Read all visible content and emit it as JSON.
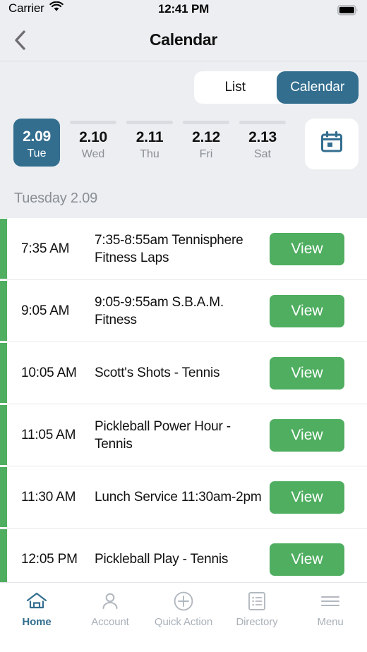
{
  "status_bar": {
    "carrier": "Carrier",
    "time": "12:41 PM",
    "wifi_icon": "wifi-icon",
    "battery_icon": "battery-full-icon"
  },
  "nav": {
    "back_icon": "chevron-left-icon",
    "title": "Calendar"
  },
  "view_toggle": {
    "options": [
      {
        "label": "List",
        "selected": false
      },
      {
        "label": "Calendar",
        "selected": true
      }
    ]
  },
  "date_strip": {
    "days": [
      {
        "date": "2.09",
        "day": "Tue",
        "selected": true
      },
      {
        "date": "2.10",
        "day": "Wed",
        "selected": false
      },
      {
        "date": "2.11",
        "day": "Thu",
        "selected": false
      },
      {
        "date": "2.12",
        "day": "Fri",
        "selected": false
      },
      {
        "date": "2.13",
        "day": "Sat",
        "selected": false
      }
    ],
    "picker_icon": "calendar-icon"
  },
  "section": {
    "header": "Tuesday 2.09"
  },
  "events": [
    {
      "time": "7:35 AM",
      "title": "7:35-8:55am Tennisphere Fitness Laps",
      "action": "View"
    },
    {
      "time": "9:05 AM",
      "title": "9:05-9:55am S.B.A.M. Fitness",
      "action": "View"
    },
    {
      "time": "10:05 AM",
      "title": "Scott's Shots - Tennis",
      "action": "View"
    },
    {
      "time": "11:05 AM",
      "title": "Pickleball Power Hour - Tennis",
      "action": "View"
    },
    {
      "time": "11:30 AM",
      "title": "Lunch Service 11:30am-2pm",
      "action": "View"
    },
    {
      "time": "12:05 PM",
      "title": "Pickleball Play - Tennis",
      "action": "View"
    }
  ],
  "tabbar": {
    "items": [
      {
        "label": "Home",
        "icon": "home-icon",
        "active": true
      },
      {
        "label": "Account",
        "icon": "person-icon",
        "active": false
      },
      {
        "label": "Quick Action",
        "icon": "plus-circle-icon",
        "active": false
      },
      {
        "label": "Directory",
        "icon": "list-doc-icon",
        "active": false
      },
      {
        "label": "Menu",
        "icon": "hamburger-icon",
        "active": false
      }
    ]
  },
  "colors": {
    "accent_teal": "#336e8f",
    "accent_green": "#4fae60",
    "background": "#eceef1"
  }
}
